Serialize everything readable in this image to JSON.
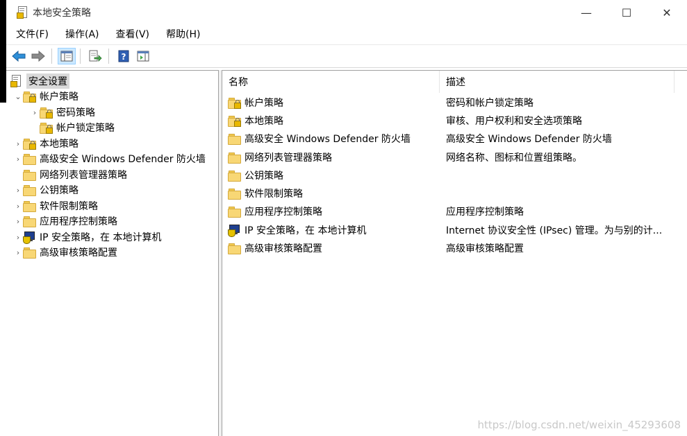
{
  "window": {
    "title": "本地安全策略",
    "controls": {
      "minimize": "—",
      "maximize": "☐",
      "close": "✕"
    }
  },
  "menu": [
    "文件(F)",
    "操作(A)",
    "查看(V)",
    "帮助(H)"
  ],
  "toolbar": {
    "buttons": [
      "back-icon",
      "forward-icon",
      "show-hide-tree-icon",
      "export-list-icon",
      "help-icon",
      "action-pane-icon"
    ]
  },
  "tree": {
    "root": "安全设置",
    "items": [
      {
        "label": "帐户策略",
        "expander": "⌄",
        "icon": "folder-lock-icon"
      },
      {
        "label": "密码策略",
        "expander": "›",
        "icon": "folder-lock-icon"
      },
      {
        "label": "帐户锁定策略",
        "expander": "",
        "icon": "folder-lock-icon"
      },
      {
        "label": "本地策略",
        "expander": "›",
        "icon": "folder-lock-icon"
      },
      {
        "label": "高级安全 Windows Defender 防火墙",
        "expander": "›",
        "icon": "folder-icon"
      },
      {
        "label": "网络列表管理器策略",
        "expander": "",
        "icon": "folder-icon"
      },
      {
        "label": "公钥策略",
        "expander": "›",
        "icon": "folder-icon"
      },
      {
        "label": "软件限制策略",
        "expander": "›",
        "icon": "folder-icon"
      },
      {
        "label": "应用程序控制策略",
        "expander": "›",
        "icon": "folder-icon"
      },
      {
        "label": "IP 安全策略，在 本地计算机",
        "expander": "›",
        "icon": "ip-security-icon"
      },
      {
        "label": "高级审核策略配置",
        "expander": "›",
        "icon": "folder-icon"
      }
    ]
  },
  "list": {
    "headers": {
      "name": "名称",
      "desc": "描述"
    },
    "rows": [
      {
        "name": "帐户策略",
        "desc": "密码和帐户锁定策略",
        "icon": "folder-lock-icon"
      },
      {
        "name": "本地策略",
        "desc": "审核、用户权利和安全选项策略",
        "icon": "folder-lock-icon"
      },
      {
        "name": "高级安全 Windows Defender 防火墙",
        "desc": "高级安全 Windows Defender 防火墙",
        "icon": "folder-icon"
      },
      {
        "name": "网络列表管理器策略",
        "desc": "网络名称、图标和位置组策略。",
        "icon": "folder-icon"
      },
      {
        "name": "公钥策略",
        "desc": "",
        "icon": "folder-icon"
      },
      {
        "name": "软件限制策略",
        "desc": "",
        "icon": "folder-icon"
      },
      {
        "name": "应用程序控制策略",
        "desc": "应用程序控制策略",
        "icon": "folder-icon"
      },
      {
        "name": "IP 安全策略，在 本地计算机",
        "desc": "Internet 协议安全性 (IPsec) 管理。为与别的计...",
        "icon": "ip-security-icon"
      },
      {
        "name": "高级审核策略配置",
        "desc": "高级审核策略配置",
        "icon": "folder-icon"
      }
    ]
  },
  "watermark": "https://blog.csdn.net/weixin_45293608"
}
